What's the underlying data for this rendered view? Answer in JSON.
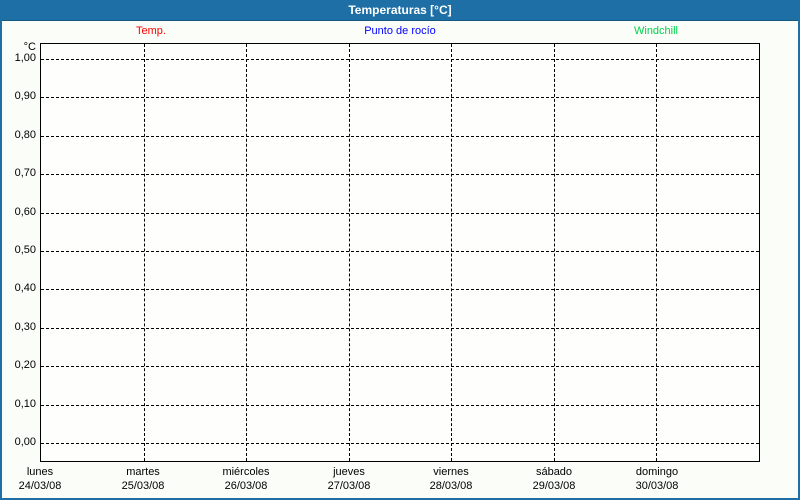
{
  "window": {
    "title": "Temperaturas [°C]"
  },
  "chart_data": {
    "type": "line",
    "title": "Temperaturas [°C]",
    "ylabel": "°C",
    "ylim": [
      0.0,
      1.0
    ],
    "y_tick_step": 0.1,
    "y_tick_labels": [
      "1,00",
      "0,90",
      "0,80",
      "0,70",
      "0,60",
      "0,50",
      "0,40",
      "0,30",
      "0,20",
      "0,10",
      "0,00"
    ],
    "grid": "dashed",
    "legend_position": "top",
    "series": [
      {
        "name": "Temp.",
        "color": "#ff0000",
        "values": []
      },
      {
        "name": "Punto de rocío",
        "color": "#0000ff",
        "values": []
      },
      {
        "name": "Windchill",
        "color": "#00d24b",
        "values": []
      }
    ],
    "x_categories": [
      {
        "weekday": "lunes",
        "date": "24/03/08"
      },
      {
        "weekday": "martes",
        "date": "25/03/08"
      },
      {
        "weekday": "miércoles",
        "date": "26/03/08"
      },
      {
        "weekday": "jueves",
        "date": "27/03/08"
      },
      {
        "weekday": "viernes",
        "date": "28/03/08"
      },
      {
        "weekday": "sábado",
        "date": "29/03/08"
      },
      {
        "weekday": "domingo",
        "date": "30/03/08"
      }
    ]
  },
  "colors": {
    "titlebar": "#1d6fa5",
    "frame_border": "#1d6fa5",
    "grid": "#000000",
    "background": "#fbfdf8",
    "plot_background": "#fefffd"
  }
}
